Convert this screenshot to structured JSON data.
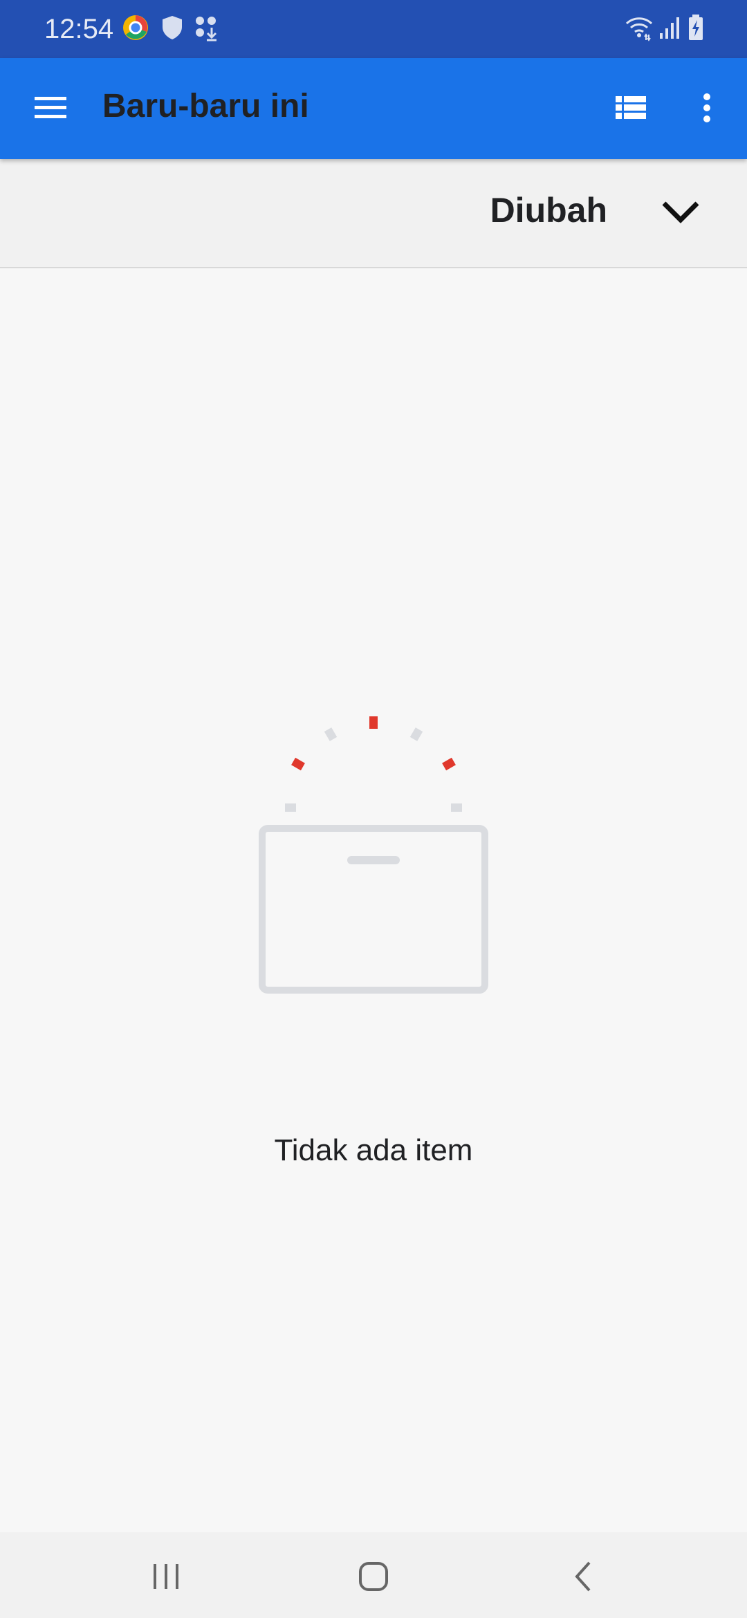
{
  "status_bar": {
    "time": "12:54",
    "icons": [
      "chrome-app-icon",
      "shield-icon",
      "apps-download-icon",
      "wifi-icon",
      "signal-icon",
      "battery-charging-icon"
    ]
  },
  "app_bar": {
    "title": "Baru-baru ini",
    "icons": [
      "menu-icon",
      "list-view-icon",
      "more-vert-icon"
    ],
    "color": "#1a73e8"
  },
  "sort_bar": {
    "label": "Diubah",
    "icon": "chevron-down-icon"
  },
  "empty_state": {
    "icon": "empty-box-icon",
    "message": "Tidak ada item"
  },
  "nav_bar": {
    "icons": [
      "recents-icon",
      "home-icon",
      "back-icon"
    ]
  }
}
